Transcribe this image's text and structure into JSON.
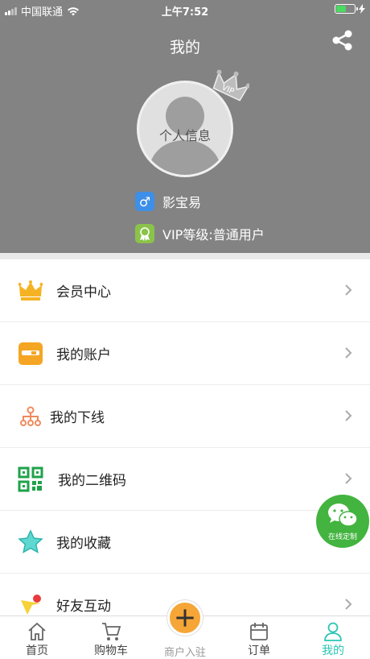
{
  "status_bar": {
    "carrier": "中国联通",
    "time": "上午7:52",
    "battery_level": 0.55
  },
  "header": {
    "title": "我的",
    "avatar_label": "个人信息",
    "username": "影宝易",
    "vip_level": "VIP等级:普通用户",
    "colors": {
      "background": "#838383",
      "gender_badge": "#3d8fe8",
      "vip_badge": "#8bc34a"
    }
  },
  "menu": {
    "items": [
      {
        "label": "会员中心",
        "icon": "crown-icon"
      },
      {
        "label": "我的账户",
        "icon": "wallet-icon"
      },
      {
        "label": "我的下线",
        "icon": "network-icon"
      },
      {
        "label": "我的二维码",
        "icon": "qr-code-icon"
      },
      {
        "label": "我的收藏",
        "icon": "star-icon"
      },
      {
        "label": "好友互动",
        "icon": "friends-icon"
      }
    ]
  },
  "floating": {
    "wechat_label": "在线定制"
  },
  "tabbar": {
    "tabs": [
      {
        "label": "首页",
        "icon": "home-icon"
      },
      {
        "label": "购物车",
        "icon": "cart-icon"
      },
      {
        "label": "商户入驻",
        "icon": "plus-icon"
      },
      {
        "label": "订单",
        "icon": "calendar-icon"
      },
      {
        "label": "我的",
        "icon": "user-icon"
      }
    ],
    "active_index": 4,
    "accent": "#2bc5b4"
  }
}
